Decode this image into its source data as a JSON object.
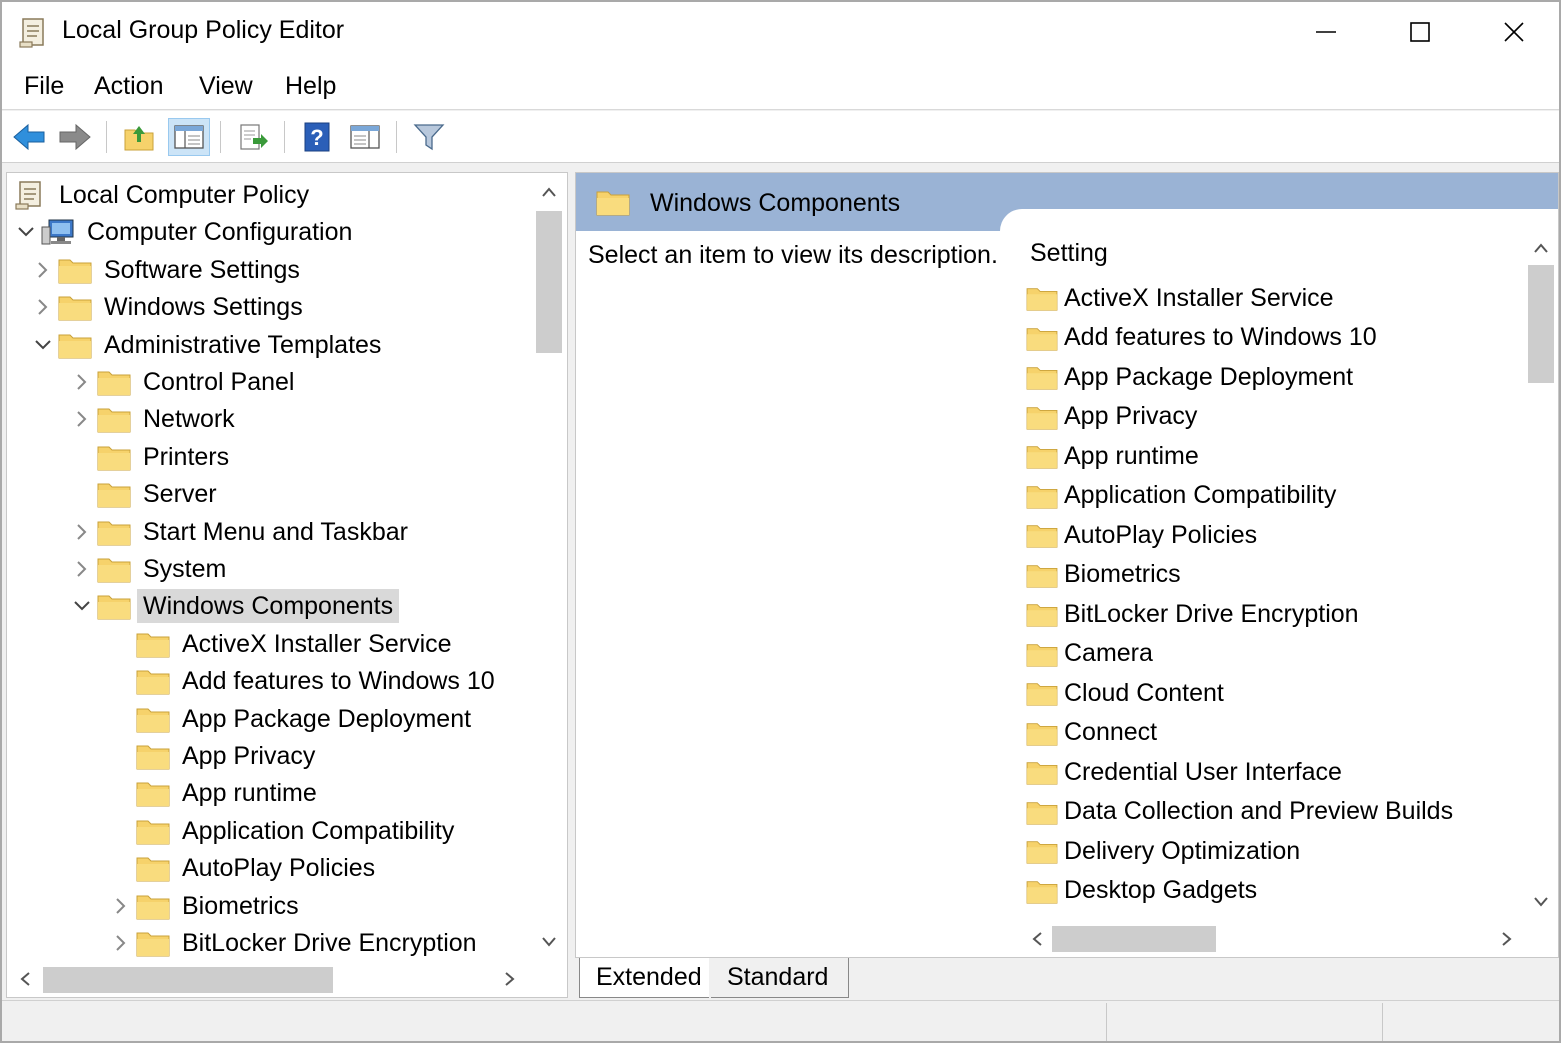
{
  "window": {
    "title": "Local Group Policy Editor"
  },
  "menu": {
    "items": [
      "File",
      "Action",
      "View",
      "Help"
    ]
  },
  "toolbar": {
    "buttons": [
      "back-icon",
      "forward-icon",
      "up-folder-icon",
      "show-hide-tree-icon",
      "export-list-icon",
      "help-icon",
      "properties-icon",
      "filter-icon"
    ]
  },
  "tree": {
    "items": [
      {
        "label": "Local Computer Policy",
        "level": 0,
        "chevron": "none",
        "icon": "policy-scroll-icon"
      },
      {
        "label": "Computer Configuration",
        "level": 0,
        "chevron": "expanded",
        "icon": "computer-icon"
      },
      {
        "label": "Software Settings",
        "level": 1,
        "chevron": "collapsed",
        "icon": "folder-icon"
      },
      {
        "label": "Windows Settings",
        "level": 1,
        "chevron": "collapsed",
        "icon": "folder-icon"
      },
      {
        "label": "Administrative Templates",
        "level": 1,
        "chevron": "expanded",
        "icon": "folder-icon"
      },
      {
        "label": "Control Panel",
        "level": 2,
        "chevron": "collapsed",
        "icon": "folder-icon"
      },
      {
        "label": "Network",
        "level": 2,
        "chevron": "collapsed",
        "icon": "folder-icon"
      },
      {
        "label": "Printers",
        "level": 2,
        "chevron": "none",
        "icon": "folder-icon"
      },
      {
        "label": "Server",
        "level": 2,
        "chevron": "none",
        "icon": "folder-icon"
      },
      {
        "label": "Start Menu and Taskbar",
        "level": 2,
        "chevron": "collapsed",
        "icon": "folder-icon"
      },
      {
        "label": "System",
        "level": 2,
        "chevron": "collapsed",
        "icon": "folder-icon"
      },
      {
        "label": "Windows Components",
        "level": 2,
        "chevron": "expanded",
        "icon": "folder-icon",
        "selected": true
      },
      {
        "label": "ActiveX Installer Service",
        "level": 3,
        "chevron": "none",
        "icon": "folder-icon"
      },
      {
        "label": "Add features to Windows 10",
        "level": 3,
        "chevron": "none",
        "icon": "folder-icon"
      },
      {
        "label": "App Package Deployment",
        "level": 3,
        "chevron": "none",
        "icon": "folder-icon"
      },
      {
        "label": "App Privacy",
        "level": 3,
        "chevron": "none",
        "icon": "folder-icon"
      },
      {
        "label": "App runtime",
        "level": 3,
        "chevron": "none",
        "icon": "folder-icon"
      },
      {
        "label": "Application Compatibility",
        "level": 3,
        "chevron": "none",
        "icon": "folder-icon"
      },
      {
        "label": "AutoPlay Policies",
        "level": 3,
        "chevron": "none",
        "icon": "folder-icon"
      },
      {
        "label": "Biometrics",
        "level": 3,
        "chevron": "collapsed",
        "icon": "folder-icon"
      },
      {
        "label": "BitLocker Drive Encryption",
        "level": 3,
        "chevron": "collapsed",
        "icon": "folder-icon"
      }
    ]
  },
  "details": {
    "header_title": "Windows Components",
    "description": "Select an item to view its description.",
    "column_header": "Setting",
    "items": [
      "ActiveX Installer Service",
      "Add features to Windows 10",
      "App Package Deployment",
      "App Privacy",
      "App runtime",
      "Application Compatibility",
      "AutoPlay Policies",
      "Biometrics",
      "BitLocker Drive Encryption",
      "Camera",
      "Cloud Content",
      "Connect",
      "Credential User Interface",
      "Data Collection and Preview Builds",
      "Delivery Optimization",
      "Desktop Gadgets"
    ]
  },
  "tabs": {
    "extended": "Extended",
    "standard": "Standard",
    "active": "Extended"
  },
  "colors": {
    "header_band": "#9ab3d5",
    "folder": "#f6d26b",
    "selection": "#d9d9d9",
    "accent": "#1e88e5"
  }
}
